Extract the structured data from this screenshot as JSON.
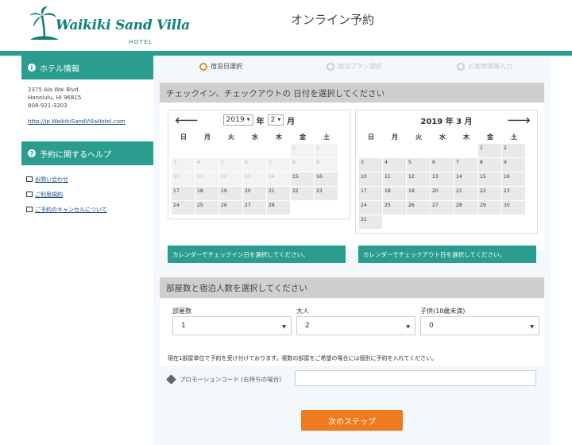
{
  "brand": {
    "logo_text": "Waikiki Sand Villa",
    "logo_sub": "HOTEL"
  },
  "page_title": "オンライン予約",
  "sidebar": {
    "hotel_info_heading": "ホテル情報",
    "address_line1": "2375 Ala Wai Blvd.",
    "address_line2": "Honolulu, HI 96815",
    "phone": "808-921-3203",
    "website": "http://jp.WaikikiSandVillaHotel.com",
    "help_heading": "予約に関するヘルプ",
    "help_items": [
      {
        "label": "お問い合わせ",
        "icon": "envelope-icon"
      },
      {
        "label": "ご利用規約",
        "icon": "document-icon"
      },
      {
        "label": "ご予約のキャンセルについて",
        "icon": "document-icon"
      }
    ]
  },
  "steps": [
    {
      "label": "宿泊日選択",
      "state": "active"
    },
    {
      "label": "宿泊プラン選択",
      "state": "inactive"
    },
    {
      "label": "お客様情報入力",
      "state": "inactive"
    }
  ],
  "date_section": {
    "heading": "チェックイン、チェックアウトの 日付を選択してください",
    "weekdays": [
      "日",
      "月",
      "火",
      "水",
      "木",
      "金",
      "土"
    ],
    "left_calendar": {
      "year": "2019",
      "year_suffix": "年",
      "month": "2",
      "month_suffix": "月",
      "prev_icon": "arrow-left-icon"
    },
    "right_calendar": {
      "title": "2019 年 3 月",
      "next_icon": "arrow-right-icon"
    },
    "checkin_hint": "カレンダーでチェックイン日を選択してください。",
    "checkout_hint": "カレンダーでチェックアウト日を選択してください。"
  },
  "room_section": {
    "heading": "部屋数と宿泊人数を選択してください",
    "rooms_label": "部屋数",
    "rooms_value": "1",
    "adults_label": "大人",
    "adults_value": "2",
    "children_label": "子供(18歳未満)",
    "children_value": "0",
    "note": "現在1部屋単位で予約を受け付けております。複数の部屋をご希望の場合には個別に予約を入れてください。"
  },
  "promo": {
    "label": "プロモーションコード (お持ちの場合)",
    "value": ""
  },
  "next_button": "次のステップ",
  "colors": {
    "teal": "#2a9d8f",
    "orange": "#f07b1e",
    "step_active": "#e98c2d"
  }
}
